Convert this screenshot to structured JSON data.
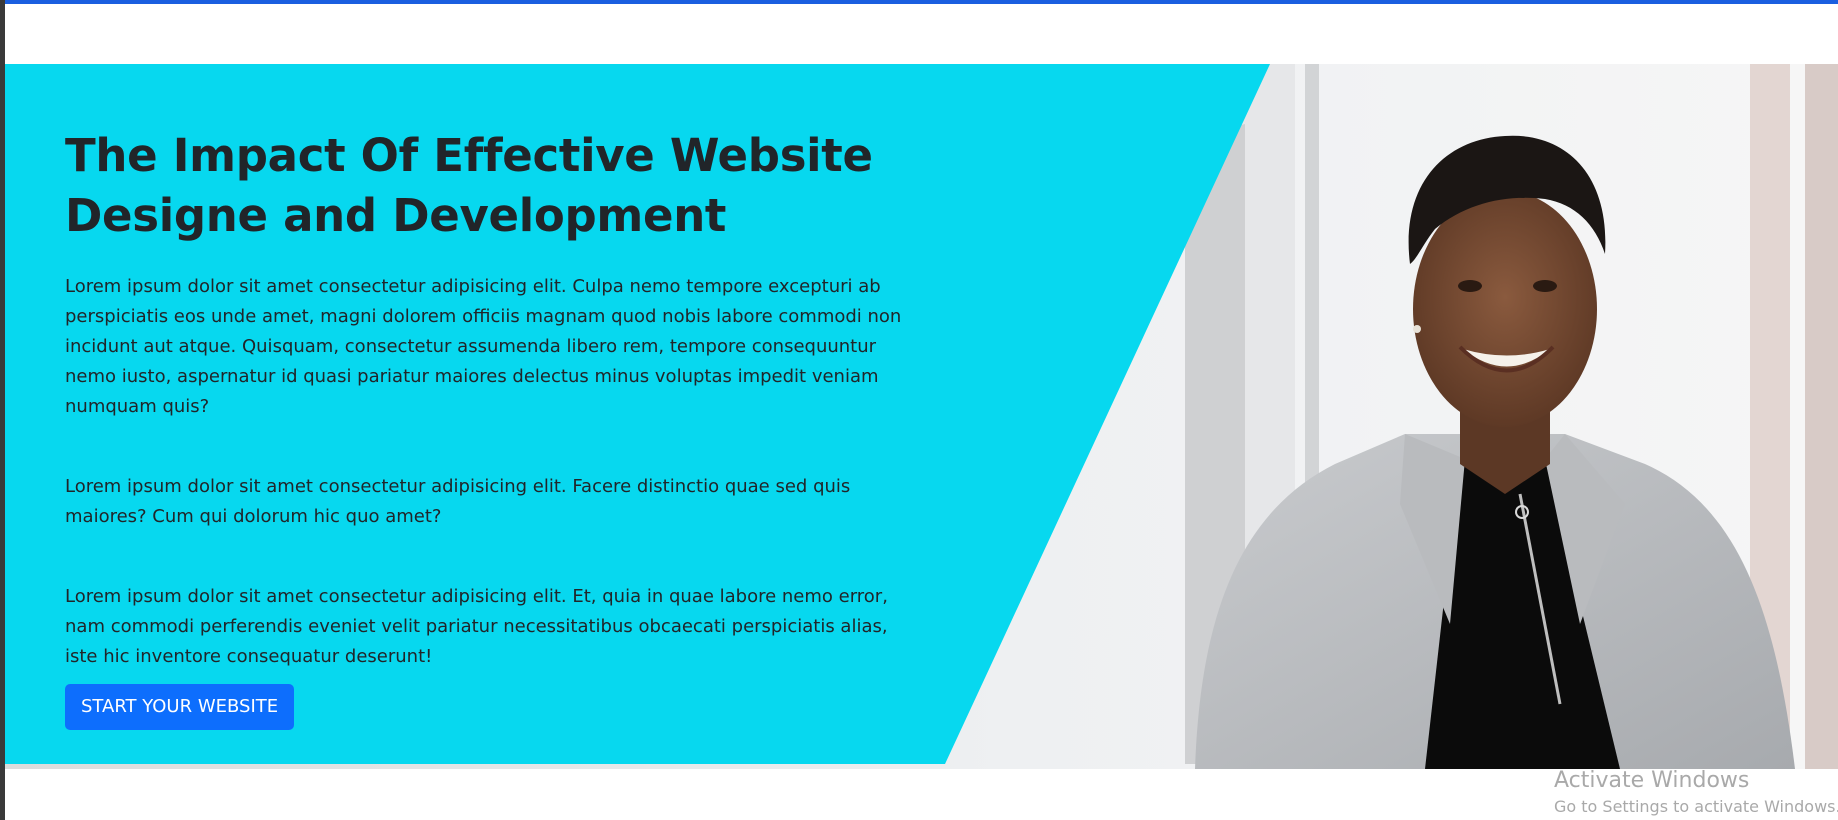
{
  "colors": {
    "top_bar": "#1a5fe0",
    "hero_panel": "#07d8ef",
    "text": "#212529",
    "button": "#0d6efd",
    "button_text": "#ffffff",
    "watermark": "#a9a9a9"
  },
  "hero": {
    "title": "The Impact Of Effective Website Designe and Development",
    "paragraphs": [
      "Lorem ipsum dolor sit amet consectetur adipisicing elit. Culpa nemo tempore excepturi ab perspiciatis eos unde amet, magni dolorem officiis magnam quod nobis labore commodi non incidunt aut atque. Quisquam, consectetur assumenda libero rem, tempore consequuntur nemo iusto, aspernatur id quasi pariatur maiores delectus minus voluptas impedit veniam numquam quis?",
      "Lorem ipsum dolor sit amet consectetur adipisicing elit. Facere distinctio quae sed quis maiores? Cum qui dolorum hic quo amet?",
      "Lorem ipsum dolor sit amet consectetur adipisicing elit. Et, quia in quae labore nemo error, nam commodi perferendis eveniet velit pariatur necessitatibus obcaecati perspiciatis alias, iste hic inventore consequatur deserunt!"
    ],
    "cta_label": "START YOUR WEBSITE",
    "image": "smiling-woman-in-grey-blazer-photo"
  },
  "watermark": {
    "title": "Activate Windows",
    "subtitle": "Go to Settings to activate Windows."
  }
}
